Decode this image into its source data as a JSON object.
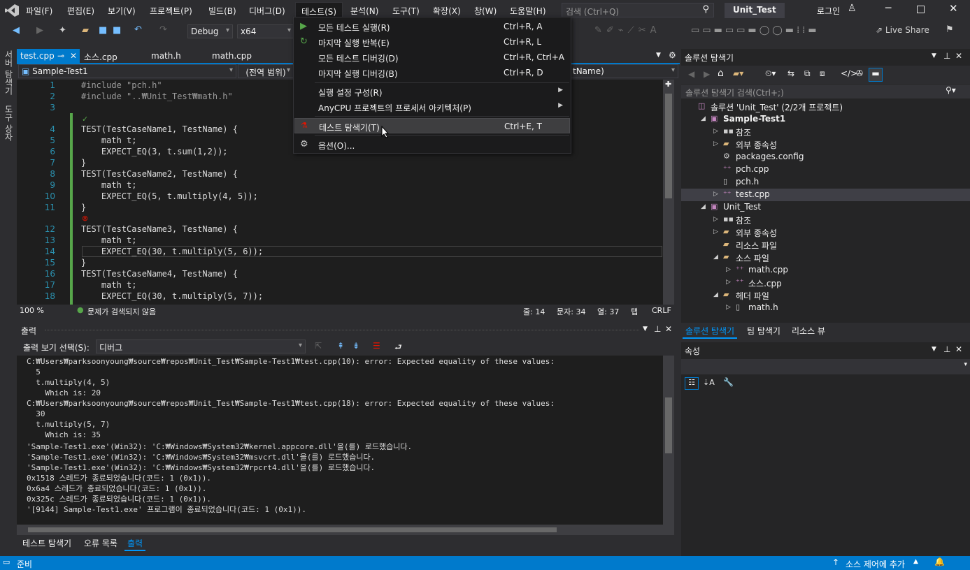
{
  "titlebar": {
    "menus": [
      "파일(F)",
      "편집(E)",
      "보기(V)",
      "프로젝트(P)",
      "빌드(B)",
      "디버그(D)",
      "테스트(S)",
      "분석(N)",
      "도구(T)",
      "확장(X)",
      "창(W)",
      "도움말(H)"
    ],
    "search_placeholder": "검색 (Ctrl+Q)",
    "solution_name": "Unit_Test",
    "login": "로그인"
  },
  "toolbar": {
    "config": "Debug",
    "platform": "x64",
    "live_share": "Live Share"
  },
  "left_strip": {
    "server": "서버 탐색기",
    "toolbox": "도구 상자"
  },
  "doc_tabs": [
    "test.cpp",
    "소스.cpp",
    "math.h",
    "math.cpp"
  ],
  "navbar": {
    "project": "Sample-Test1",
    "scope": "(전역 범위)",
    "member": "tName)"
  },
  "code": [
    {
      "n": "1",
      "t": "#include \"pch.h\""
    },
    {
      "n": "2",
      "t": "#include \"..₩Unit_Test₩math.h\""
    },
    {
      "n": "3",
      "t": ""
    },
    {
      "n": "4",
      "t": "TEST(TestCaseName1, TestName) {"
    },
    {
      "n": "5",
      "t": "    math t;"
    },
    {
      "n": "6",
      "t": "    EXPECT_EQ(3, t.sum(1,2));"
    },
    {
      "n": "7",
      "t": "}"
    },
    {
      "n": "8",
      "t": "TEST(TestCaseName2, TestName) {"
    },
    {
      "n": "9",
      "t": "    math t;"
    },
    {
      "n": "10",
      "t": "    EXPECT_EQ(5, t.multiply(4, 5));"
    },
    {
      "n": "11",
      "t": "}"
    },
    {
      "n": "12",
      "t": "TEST(TestCaseName3, TestName) {"
    },
    {
      "n": "13",
      "t": "    math t;"
    },
    {
      "n": "14",
      "t": "    EXPECT_EQ(30, t.multiply(5, 6));"
    },
    {
      "n": "15",
      "t": "}"
    },
    {
      "n": "16",
      "t": "TEST(TestCaseName4, TestName) {"
    },
    {
      "n": "17",
      "t": "    math t;"
    },
    {
      "n": "18",
      "t": "    EXPECT_EQ(30, t.multiply(5, 7));"
    }
  ],
  "editor_status": {
    "zoom": "100 %",
    "issues": "문제가 검색되지 않음",
    "line": "줄: 14",
    "char": "문자: 34",
    "col": "열: 37",
    "mode": "탭",
    "eol": "CRLF"
  },
  "output": {
    "title": "출력",
    "select_label": "출력 보기 선택(S):",
    "select_value": "디버그",
    "lines": [
      "C:₩Users₩parksoonyoung₩source₩repos₩Unit_Test₩Sample-Test1₩test.cpp(10): error: Expected equality of these values:",
      "  5",
      "  t.multiply(4, 5)",
      "    Which is: 20",
      "C:₩Users₩parksoonyoung₩source₩repos₩Unit_Test₩Sample-Test1₩test.cpp(18): error: Expected equality of these values:",
      "  30",
      "  t.multiply(5, 7)",
      "    Which is: 35",
      "'Sample-Test1.exe'(Win32): 'C:₩Windows₩System32₩kernel.appcore.dll'을(를) 로드했습니다.",
      "'Sample-Test1.exe'(Win32): 'C:₩Windows₩System32₩msvcrt.dll'을(를) 로드했습니다.",
      "'Sample-Test1.exe'(Win32): 'C:₩Windows₩System32₩rpcrt4.dll'을(를) 로드했습니다.",
      "0x1518 스레드가 종료되었습니다(코드: 1 (0x1)).",
      "0x6a4 스레드가 종료되었습니다(코드: 1 (0x1)).",
      "0x325c 스레드가 종료되었습니다(코드: 1 (0x1)).",
      "'[9144] Sample-Test1.exe' 프로그램이 종료되었습니다(코드: 1 (0x1))."
    ]
  },
  "bottom_tabs": [
    "테스트 탐색기",
    "오류 목록",
    "출력"
  ],
  "statusbar": {
    "ready": "준비",
    "source_control": "소스 제어에 추가"
  },
  "solution_explorer": {
    "title": "솔루션 탐색기",
    "search_placeholder": "솔루션 탐색기 검색(Ctrl+;)",
    "items": [
      {
        "label": "솔루션 'Unit_Test' (2/2개 프로젝트)",
        "depth": 0,
        "exp": "",
        "icon": "solution-icon",
        "bold": false
      },
      {
        "label": "Sample-Test1",
        "depth": 1,
        "exp": "▲",
        "icon": "project-icon",
        "bold": true
      },
      {
        "label": "참조",
        "depth": 2,
        "exp": "▷",
        "icon": "references-icon",
        "bold": false
      },
      {
        "label": "외부 종속성",
        "depth": 2,
        "exp": "▷",
        "icon": "folder-icon",
        "bold": false
      },
      {
        "label": "packages.config",
        "depth": 2,
        "exp": "",
        "icon": "config-file-icon",
        "bold": false
      },
      {
        "label": "pch.cpp",
        "depth": 2,
        "exp": "",
        "icon": "cpp-file-icon",
        "bold": false
      },
      {
        "label": "pch.h",
        "depth": 2,
        "exp": "",
        "icon": "header-file-icon",
        "bold": false
      },
      {
        "label": "test.cpp",
        "depth": 2,
        "exp": "▷",
        "icon": "cpp-file-icon",
        "bold": false
      },
      {
        "label": "Unit_Test",
        "depth": 1,
        "exp": "▲",
        "icon": "project-icon",
        "bold": false
      },
      {
        "label": "참조",
        "depth": 2,
        "exp": "▷",
        "icon": "references-icon",
        "bold": false
      },
      {
        "label": "외부 종속성",
        "depth": 2,
        "exp": "▷",
        "icon": "folder-icon",
        "bold": false
      },
      {
        "label": "리소스 파일",
        "depth": 2,
        "exp": "",
        "icon": "folder-icon",
        "bold": false
      },
      {
        "label": "소스 파일",
        "depth": 2,
        "exp": "▲",
        "icon": "folder-icon",
        "bold": false
      },
      {
        "label": "math.cpp",
        "depth": 3,
        "exp": "▷",
        "icon": "cpp-file-icon",
        "bold": false
      },
      {
        "label": "소스.cpp",
        "depth": 3,
        "exp": "▷",
        "icon": "cpp-file-icon",
        "bold": false
      },
      {
        "label": "헤더 파일",
        "depth": 2,
        "exp": "▲",
        "icon": "folder-icon",
        "bold": false
      },
      {
        "label": "math.h",
        "depth": 3,
        "exp": "▷",
        "icon": "header-file-icon",
        "bold": false
      }
    ]
  },
  "sol_tabs": [
    "솔루션 탐색기",
    "팀 탐색기",
    "리소스 뷰"
  ],
  "properties": {
    "title": "속성"
  },
  "test_menu": {
    "items": [
      {
        "label": "모든 테스트 실행(R)",
        "shortcut": "Ctrl+R, A",
        "icon": "run-icon"
      },
      {
        "label": "마지막 실행 반복(E)",
        "shortcut": "Ctrl+R, L",
        "icon": "repeat-icon"
      },
      {
        "label": "모든 테스트 디버깅(D)",
        "shortcut": "Ctrl+R, Ctrl+A",
        "icon": ""
      },
      {
        "label": "마지막 실행 디버깅(B)",
        "shortcut": "Ctrl+R, D",
        "icon": ""
      },
      {
        "label": "실행 설정 구성(R)",
        "shortcut": "",
        "icon": ""
      },
      {
        "label": "AnyCPU 프로젝트의 프로세서 아키텍처(P)",
        "shortcut": "",
        "icon": ""
      },
      {
        "label": "테스트 탐색기(T)",
        "shortcut": "Ctrl+E, T",
        "icon": "test-explorer-icon"
      },
      {
        "label": "옵션(O)...",
        "shortcut": "",
        "icon": "gear-icon"
      }
    ]
  },
  "colors": {
    "accent": "#007acc",
    "background": "#2d2d30",
    "editor": "#1e1e1e",
    "menu_highlight": "#3e3e40"
  }
}
